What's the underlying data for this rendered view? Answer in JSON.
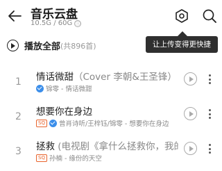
{
  "header": {
    "title": "音乐云盘",
    "storage": "10.5G / 60G",
    "info_icon": "ⓘ",
    "icons": [
      "back-arrow-icon",
      "upload-hexagon-icon",
      "search-icon"
    ]
  },
  "tooltip": {
    "text": "让上传变得更快捷"
  },
  "play_all": {
    "label": "播放全部",
    "count": "(共896首)"
  },
  "songs": [
    {
      "index": "1",
      "title": "情话微甜",
      "subtitle": "（Cover 李朝&王圣锋）",
      "badge": "",
      "meta": "锦零 - 情话微甜",
      "verified": true
    },
    {
      "index": "2",
      "title": "想要你在身边",
      "subtitle": "",
      "badge": "SQ",
      "meta": "曾肖诗听/王梓钰/锦零 - 想要你在身边",
      "verified": true
    },
    {
      "index": "3",
      "title": "拯救",
      "subtitle": " (电视剧《拿什么拯救你，我的…",
      "badge": "SQ",
      "meta": "孙楠 - 缘份的天空",
      "verified": false
    }
  ],
  "colors": {
    "verified_blue": "#3b8eea",
    "sq_orange": "#e8632b",
    "tooltip_bg": "#2f2f2f"
  }
}
